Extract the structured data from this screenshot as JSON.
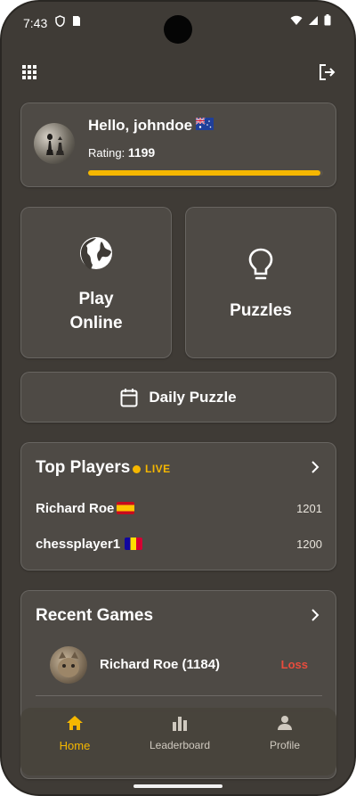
{
  "status_bar": {
    "time": "7:43"
  },
  "user": {
    "greeting": "Hello, johndoe",
    "rating_label": "Rating:",
    "rating_value": "1199",
    "rating_progress": 0.99,
    "flag": "AU"
  },
  "actions": {
    "play_online_line1": "Play",
    "play_online_line2": "Online",
    "puzzles": "Puzzles",
    "daily_puzzle": "Daily Puzzle"
  },
  "top_players": {
    "title": "Top Players",
    "live_label": "LIVE",
    "players": [
      {
        "name": "Richard Roe",
        "score": "1201",
        "flag": "ES"
      },
      {
        "name": "chessplayer1",
        "score": "1200",
        "flag": "AD"
      }
    ]
  },
  "recent_games": {
    "title": "Recent Games",
    "games": [
      {
        "opponent": "Richard Roe (1184)",
        "result": "Loss"
      }
    ]
  },
  "nav": {
    "items": [
      {
        "label": "Home",
        "icon": "home-icon",
        "active": true
      },
      {
        "label": "Leaderboard",
        "icon": "leaderboard-icon",
        "active": false
      },
      {
        "label": "Profile",
        "icon": "profile-icon",
        "active": false
      }
    ]
  },
  "colors": {
    "accent": "#f5b700",
    "loss": "#e84c3d",
    "background": "#3f3b36"
  }
}
